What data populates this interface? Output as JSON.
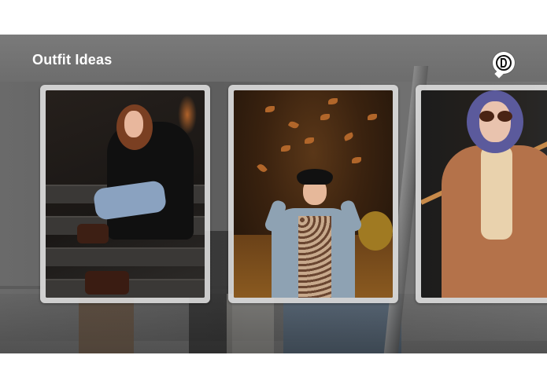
{
  "header": {
    "title": "Outfit Ideas"
  },
  "logo": {
    "icon": "app-logo-icon"
  },
  "cards": [
    {
      "subject": "woman-on-stairs-photo"
    },
    {
      "subject": "autumn-leaves-photo"
    },
    {
      "subject": "orange-coat-photo"
    }
  ],
  "colors": {
    "title": "#ffffff",
    "card_frame": "#dcdcdc",
    "screen_bg": "#6c6c6c"
  }
}
